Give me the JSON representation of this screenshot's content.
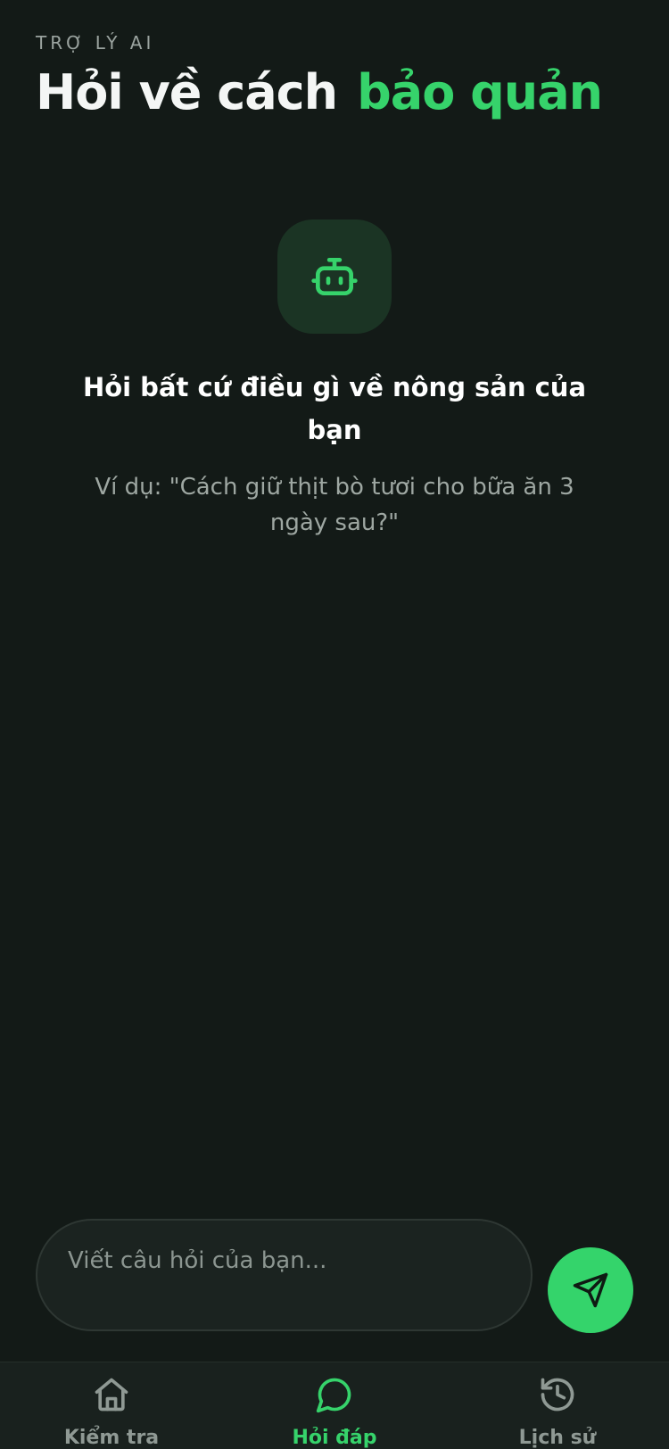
{
  "header": {
    "eyebrow": "TRỢ LÝ AI",
    "title_plain": "Hỏi về cách",
    "title_accent": "bảo quản"
  },
  "empty_state": {
    "icon": "robot-icon",
    "title": "Hỏi bất cứ điều gì về nông sản của bạn",
    "hint": "Ví dụ: \"Cách giữ thịt bò tươi cho bữa ăn 3 ngày sau?\""
  },
  "composer": {
    "placeholder": "Viết câu hỏi của bạn...",
    "value": "",
    "send_icon": "send-icon"
  },
  "tabbar": {
    "tabs": [
      {
        "label": "Kiểm tra",
        "icon": "home-icon",
        "active": false
      },
      {
        "label": "Hỏi đáp",
        "icon": "chat-bubble-icon",
        "active": true
      },
      {
        "label": "Lịch sử",
        "icon": "history-icon",
        "active": false
      }
    ]
  },
  "colors": {
    "background": "#131a17",
    "accent": "#36d36b",
    "muted_text": "#9ea7a2",
    "tile": "#1b3424"
  }
}
